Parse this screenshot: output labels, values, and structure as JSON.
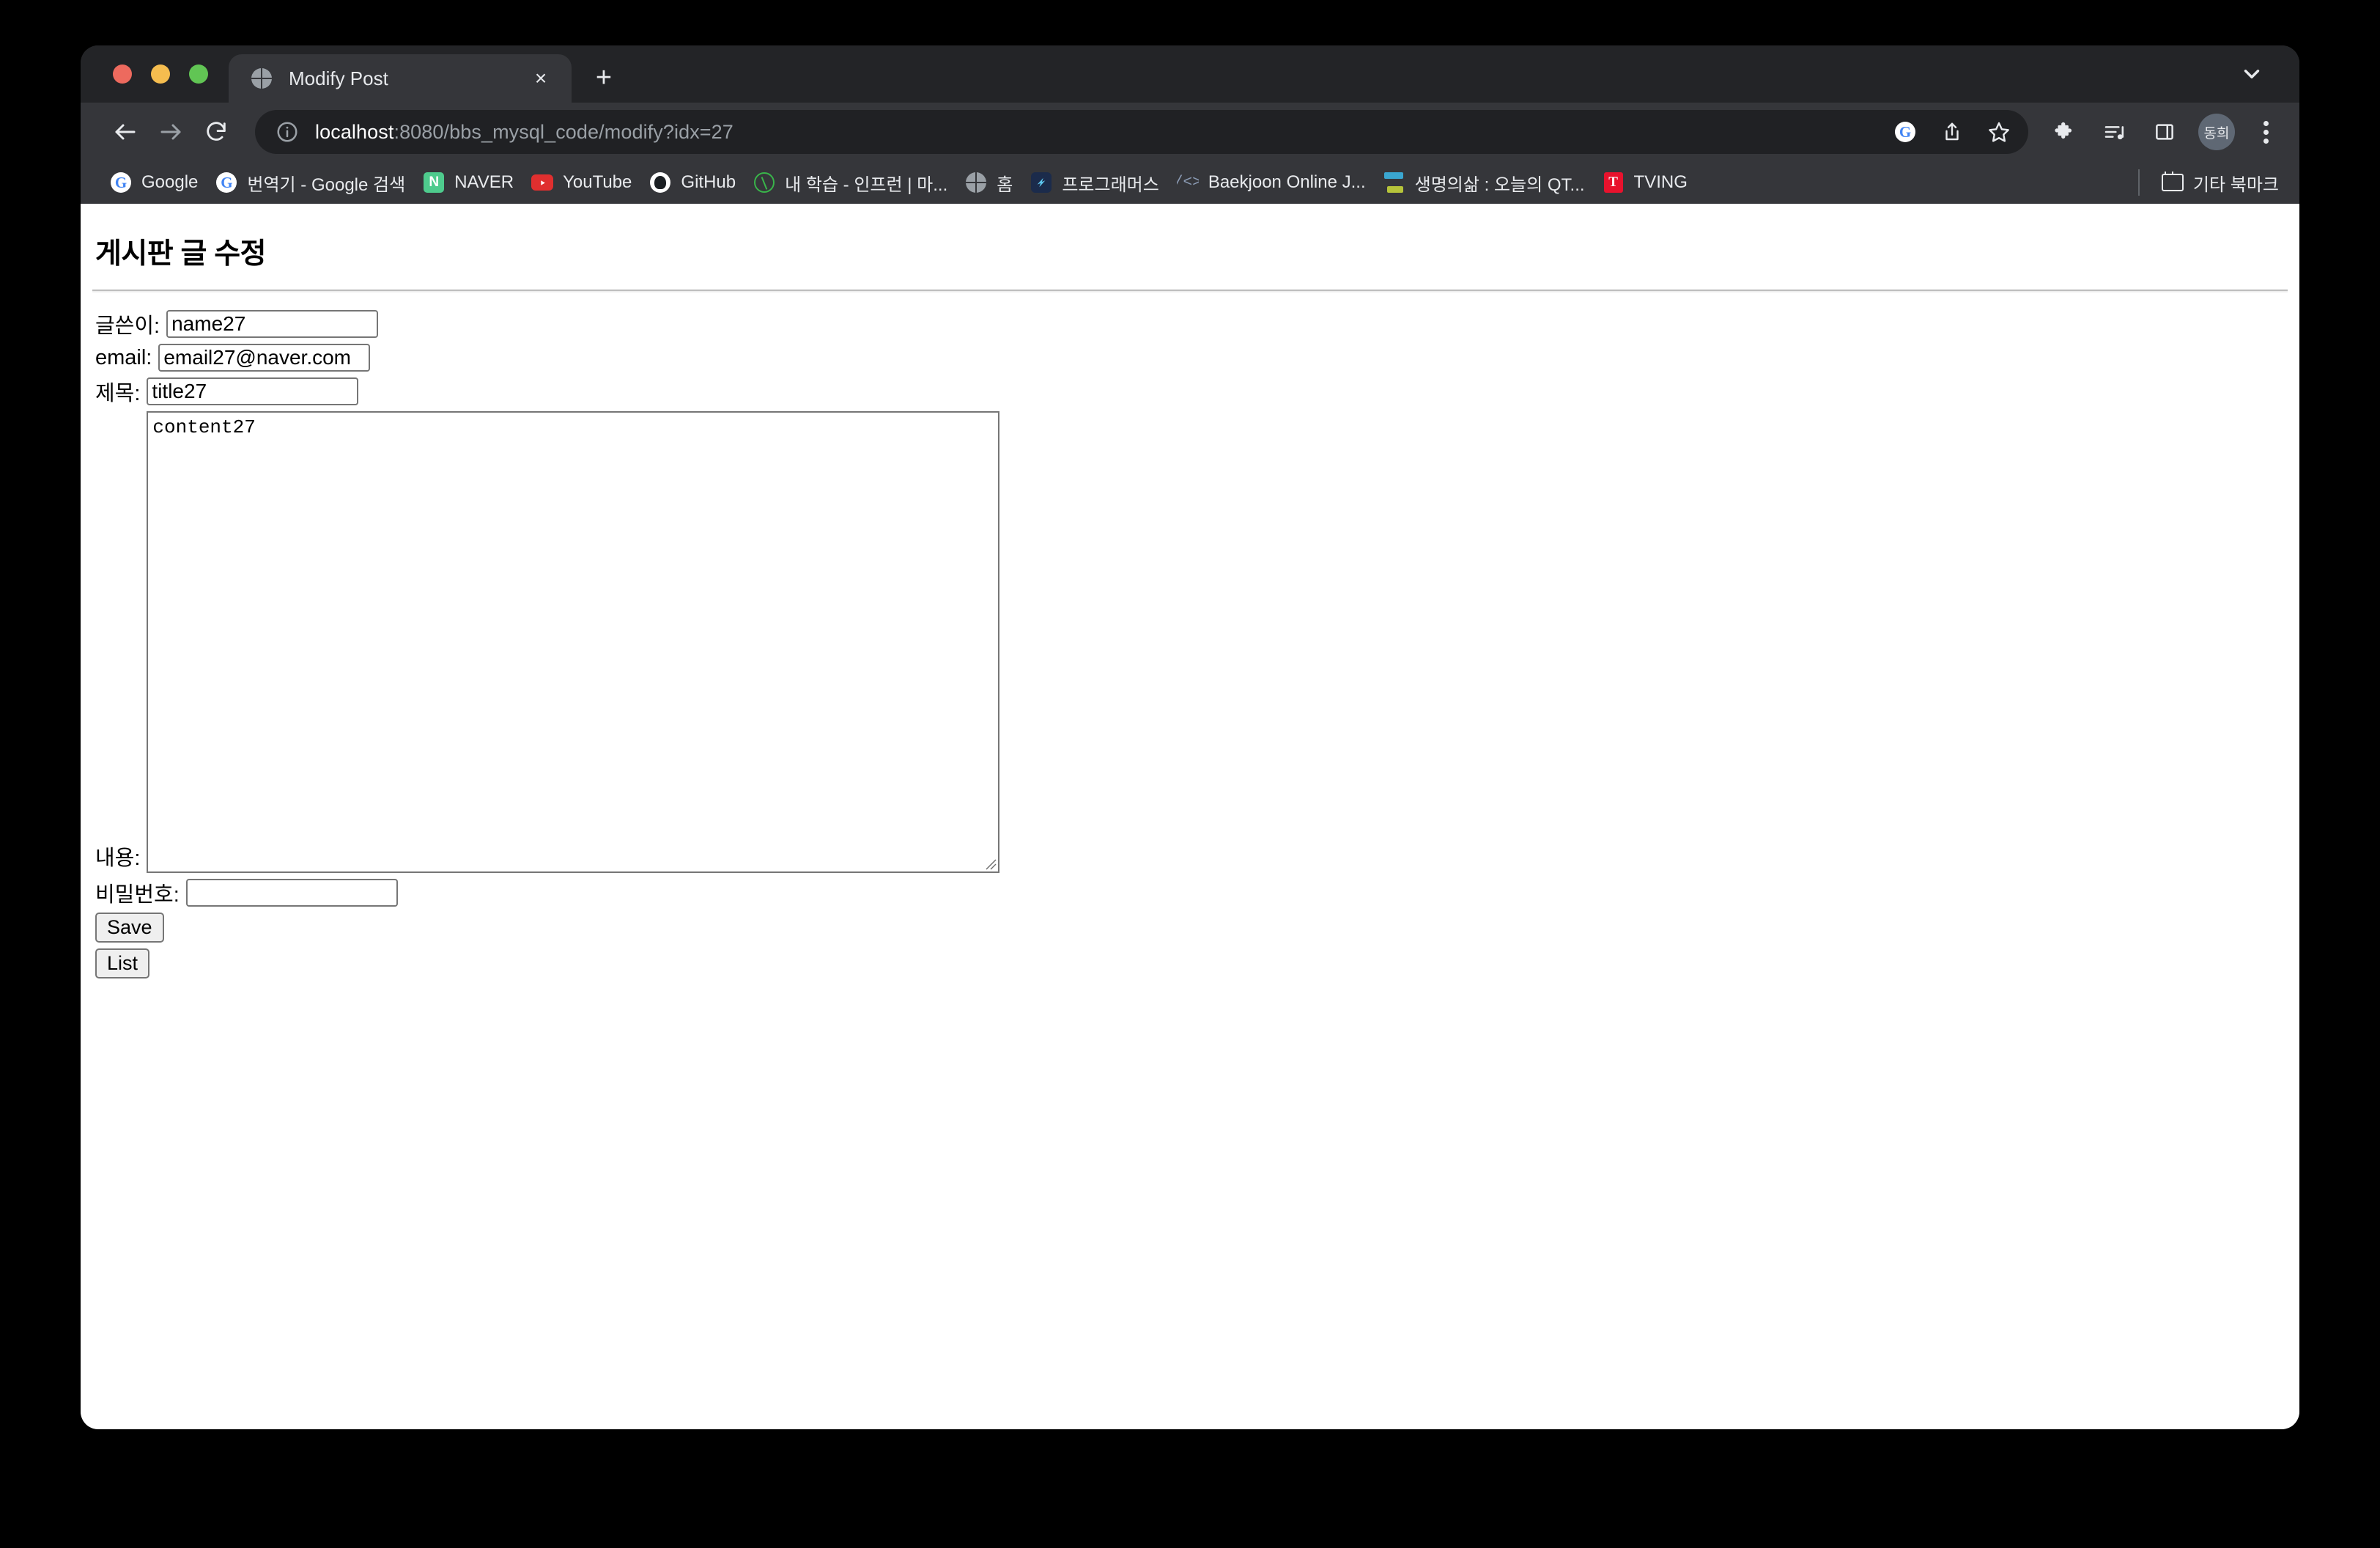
{
  "browser": {
    "tab": {
      "title": "Modify Post",
      "favicon": "globe-icon",
      "close_label": "×"
    },
    "new_tab_label": "+",
    "toolbar": {
      "back_label": "←",
      "forward_label": "→",
      "reload_label": "↻",
      "url_host": "localhost",
      "url_rest": ":8080/bbs_mysql_code/modify?idx=27",
      "url_full": "localhost:8080/bbs_mysql_code/modify?idx=27",
      "avatar_initials": "동희"
    },
    "bookmarks": [
      {
        "label": "Google",
        "icon": "google-icon"
      },
      {
        "label": "번역기 - Google 검색",
        "icon": "google-icon"
      },
      {
        "label": "NAVER",
        "icon": "naver-icon"
      },
      {
        "label": "YouTube",
        "icon": "youtube-icon"
      },
      {
        "label": "GitHub",
        "icon": "github-icon"
      },
      {
        "label": "내 학습 - 인프런 | 마...",
        "icon": "inflearn-icon"
      },
      {
        "label": "홈",
        "icon": "globe-icon"
      },
      {
        "label": "프로그래머스",
        "icon": "programmers-icon"
      },
      {
        "label": "Baekjoon Online J...",
        "icon": "baekjoon-icon"
      },
      {
        "label": "생명의삶 : 오늘의 QT...",
        "icon": "qt-icon"
      },
      {
        "label": "TVING",
        "icon": "tving-icon"
      }
    ],
    "other_bookmarks": {
      "label": "기타 북마크",
      "icon": "folder-icon"
    }
  },
  "page": {
    "title": "게시판 글 수정",
    "fields": {
      "writer": {
        "label": "글쓴이:",
        "value": "name27",
        "placeholder": ""
      },
      "email": {
        "label": "email:",
        "value": "email27@naver.com",
        "placeholder": ""
      },
      "subject": {
        "label": "제목:",
        "value": "title27",
        "placeholder": ""
      },
      "content": {
        "label": "내용:",
        "value": "content27",
        "placeholder": ""
      },
      "password": {
        "label": "비밀번호:",
        "value": "",
        "placeholder": ""
      }
    },
    "buttons": {
      "save": "Save",
      "list": "List"
    }
  },
  "colors": {
    "tab_strip": "#232427",
    "toolbar": "#35363a",
    "omnibox": "#202124",
    "page_bg": "#ffffff",
    "text_light": "#e8eaed",
    "url_muted": "#9aa0a6",
    "avatar_bg": "#5f6874",
    "button_bg": "#efefef",
    "field_border": "#767676"
  }
}
